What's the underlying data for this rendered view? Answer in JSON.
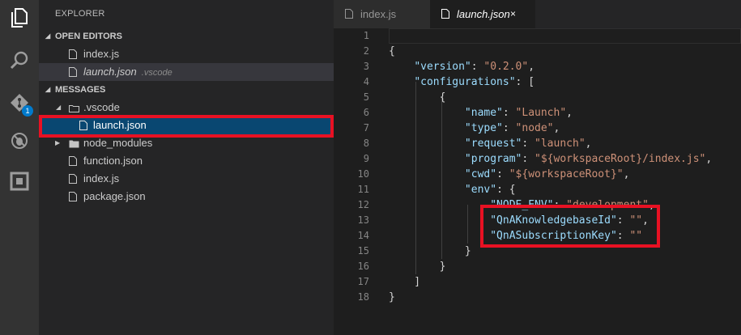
{
  "sidebar": {
    "title": "EXPLORER",
    "open_editors": {
      "header": "OPEN EDITORS",
      "items": [
        {
          "label": "index.js",
          "desc": ""
        },
        {
          "label": "launch.json",
          "desc": ".vscode"
        }
      ]
    },
    "messages": {
      "header": "MESSAGES",
      "folder_vscode": ".vscode",
      "launch_json": "launch.json",
      "folder_node_modules": "node_modules",
      "files": [
        "function.json",
        "index.js",
        "package.json"
      ]
    }
  },
  "activity_bar": {
    "icons": [
      "files-icon",
      "search-icon",
      "git-icon",
      "debug-icon",
      "extensions-icon"
    ],
    "git_badge": "1"
  },
  "tabs": [
    {
      "label": "index.js",
      "active": false
    },
    {
      "label": "launch.json",
      "active": true,
      "close": "×"
    }
  ],
  "editor": {
    "line_numbers": [
      "1",
      "2",
      "3",
      "4",
      "5",
      "6",
      "7",
      "8",
      "9",
      "10",
      "11",
      "12",
      "13",
      "14",
      "15",
      "16",
      "17",
      "18"
    ],
    "lines": [
      [],
      [
        [
          "p",
          "{"
        ]
      ],
      [
        [
          "p",
          "    "
        ],
        [
          "k",
          "\"version\""
        ],
        [
          "p",
          ": "
        ],
        [
          "s",
          "\"0.2.0\""
        ],
        [
          "p",
          ","
        ]
      ],
      [
        [
          "p",
          "    "
        ],
        [
          "k",
          "\"configurations\""
        ],
        [
          "p",
          ": ["
        ]
      ],
      [
        [
          "p",
          "        {"
        ]
      ],
      [
        [
          "p",
          "            "
        ],
        [
          "k",
          "\"name\""
        ],
        [
          "p",
          ": "
        ],
        [
          "s",
          "\"Launch\""
        ],
        [
          "p",
          ","
        ]
      ],
      [
        [
          "p",
          "            "
        ],
        [
          "k",
          "\"type\""
        ],
        [
          "p",
          ": "
        ],
        [
          "s",
          "\"node\""
        ],
        [
          "p",
          ","
        ]
      ],
      [
        [
          "p",
          "            "
        ],
        [
          "k",
          "\"request\""
        ],
        [
          "p",
          ": "
        ],
        [
          "s",
          "\"launch\""
        ],
        [
          "p",
          ","
        ]
      ],
      [
        [
          "p",
          "            "
        ],
        [
          "k",
          "\"program\""
        ],
        [
          "p",
          ": "
        ],
        [
          "s",
          "\"${workspaceRoot}/index.js\""
        ],
        [
          "p",
          ","
        ]
      ],
      [
        [
          "p",
          "            "
        ],
        [
          "k",
          "\"cwd\""
        ],
        [
          "p",
          ": "
        ],
        [
          "s",
          "\"${workspaceRoot}\""
        ],
        [
          "p",
          ","
        ]
      ],
      [
        [
          "p",
          "            "
        ],
        [
          "k",
          "\"env\""
        ],
        [
          "p",
          ": {"
        ]
      ],
      [
        [
          "p",
          "                "
        ],
        [
          "k",
          "\"NODE_ENV\""
        ],
        [
          "p",
          ": "
        ],
        [
          "s",
          "\"development\""
        ],
        [
          "p",
          ","
        ]
      ],
      [
        [
          "p",
          "                "
        ],
        [
          "k",
          "\"QnAKnowledgebaseId\""
        ],
        [
          "p",
          ": "
        ],
        [
          "s",
          "\"\""
        ],
        [
          "p",
          ","
        ]
      ],
      [
        [
          "p",
          "                "
        ],
        [
          "k",
          "\"QnASubscriptionKey\""
        ],
        [
          "p",
          ": "
        ],
        [
          "s",
          "\"\""
        ]
      ],
      [
        [
          "p",
          "            }"
        ]
      ],
      [
        [
          "p",
          "        }"
        ]
      ],
      [
        [
          "p",
          "    ]"
        ]
      ],
      [
        [
          "p",
          "}"
        ]
      ]
    ]
  },
  "colors": {
    "highlight_box": "#e81123",
    "selection": "#094771",
    "json_key": "#9cdcfe",
    "json_string": "#ce9178"
  }
}
